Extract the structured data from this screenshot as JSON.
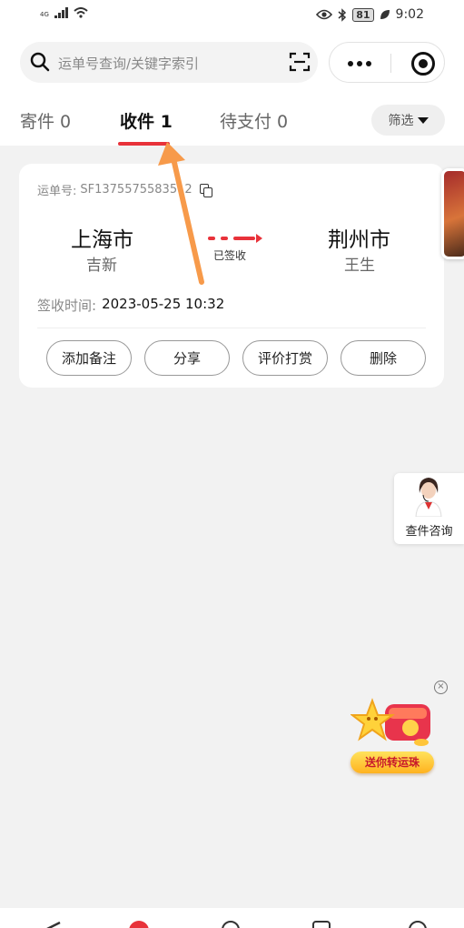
{
  "status_bar": {
    "network": "4G",
    "battery": "81",
    "time": "9:02"
  },
  "search": {
    "placeholder": "运单号查询/关键字索引"
  },
  "tabs": [
    {
      "label": "寄件 0",
      "active": false
    },
    {
      "label": "收件 1",
      "active": true
    },
    {
      "label": "待支付 0",
      "active": false
    }
  ],
  "filter": {
    "label": "筛选"
  },
  "shipment": {
    "waybill_label": "运单号:",
    "waybill_number": "SF1375575583512",
    "from_city": "上海市",
    "from_person": "吉新",
    "to_city": "荆州市",
    "to_person": "王生",
    "status": "已签收",
    "sign_time_label": "签收时间:",
    "sign_time": "2023-05-25 10:32",
    "actions": [
      "添加备注",
      "分享",
      "评价打赏",
      "删除"
    ]
  },
  "support": {
    "label": "查件咨询"
  },
  "promo": {
    "label": "送你转运珠",
    "close": "×"
  },
  "colors": {
    "accent": "#e8323a",
    "annotation_arrow": "#f79a4a"
  }
}
